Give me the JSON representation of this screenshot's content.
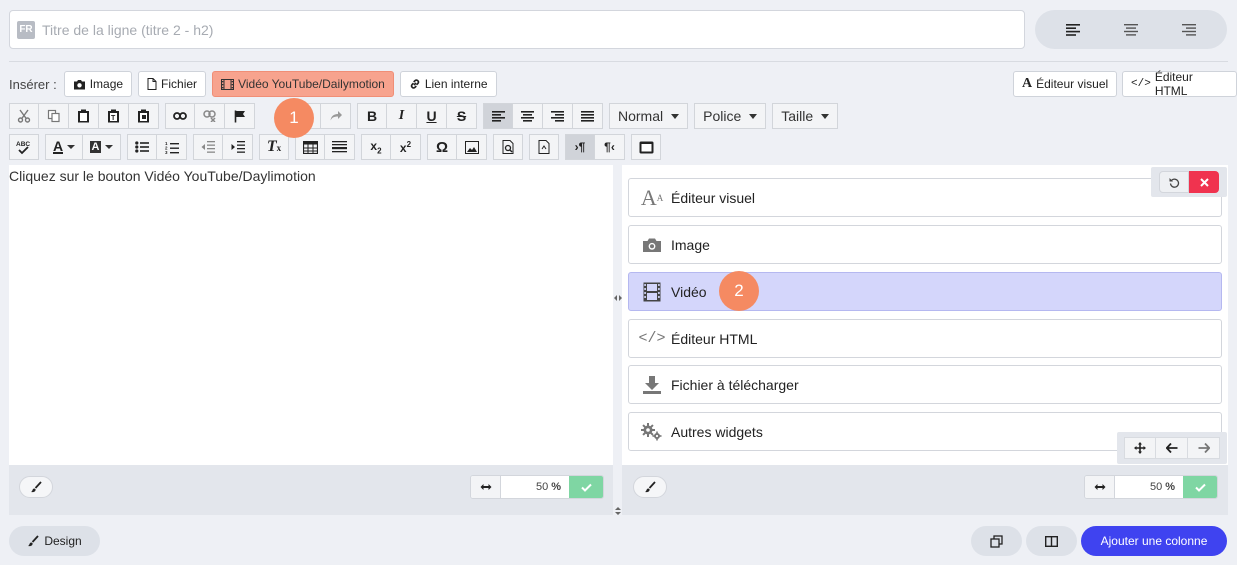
{
  "title": {
    "lang": "FR",
    "placeholder": "Titre de la ligne (titre 2 - h2)"
  },
  "align_buttons": [
    "align-left-icon",
    "align-center-icon",
    "align-right-icon"
  ],
  "insert": {
    "label": "Insérer :",
    "image": "Image",
    "file": "Fichier",
    "video": "Vidéo YouTube/Dailymotion",
    "internal_link": "Lien interne"
  },
  "editor_switch": {
    "visual": "Éditeur visuel",
    "html": "Éditeur HTML"
  },
  "toolbar": {
    "format": "Normal",
    "font": "Police",
    "size": "Taille"
  },
  "markers": {
    "first": "1",
    "second": "2"
  },
  "left_pane": {
    "text": "Cliquez sur le bouton Vidéo YouTube/Daylimotion"
  },
  "widgets": [
    {
      "label": "Éditeur visuel",
      "icon": "font-icon"
    },
    {
      "label": "Image",
      "icon": "camera-icon"
    },
    {
      "label": "Vidéo",
      "icon": "film-icon",
      "selected": true
    },
    {
      "label": "Éditeur HTML",
      "icon": "code-icon"
    },
    {
      "label": "Fichier à télécharger",
      "icon": "download-icon"
    },
    {
      "label": "Autres widgets",
      "icon": "gears-icon"
    }
  ],
  "width_left": {
    "value": "50",
    "unit": "%"
  },
  "width_right": {
    "value": "50",
    "unit": "%"
  },
  "bottom": {
    "design": "Design",
    "add_column": "Ajouter une colonne"
  },
  "colors": {
    "accent": "#3f43f0",
    "video_active": "#f7a38e",
    "marker": "#f58a62",
    "selected_widget": "#d4d6fb",
    "close": "#f0334f",
    "confirm": "#7fd6a3"
  }
}
